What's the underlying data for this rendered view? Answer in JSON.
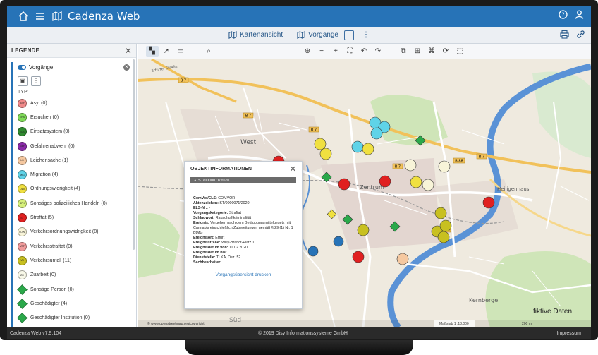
{
  "app": {
    "title": "Cadenza Web"
  },
  "header": {
    "help_icon": "help-circle-icon",
    "user_icon": "user-icon"
  },
  "nav": {
    "tabs": [
      {
        "label": "Kartenansicht",
        "icon": "map-icon"
      },
      {
        "label": "Vorgänge",
        "icon": "map-icon"
      }
    ]
  },
  "legend": {
    "title": "LEGENDE",
    "layer": {
      "label": "Vorgänge"
    },
    "typ_label": "TYP",
    "items": [
      {
        "label": "Asyl (0)",
        "abbr": "ASY",
        "color": "#f08a8a",
        "shape": "circle"
      },
      {
        "label": "Ersuchen (0)",
        "abbr": "ERS",
        "color": "#7ed957",
        "shape": "circle"
      },
      {
        "label": "Einsatzsystem (0)",
        "abbr": "ELS",
        "color": "#2f8a2f",
        "shape": "circle"
      },
      {
        "label": "Gefahrenabwehr (0)",
        "abbr": "GEF",
        "color": "#8a2aa8",
        "shape": "circle"
      },
      {
        "label": "Leichensache (1)",
        "abbr": "LS",
        "color": "#f5c8a0",
        "shape": "circle"
      },
      {
        "label": "Migration (4)",
        "abbr": "MIG",
        "color": "#5fd3e8",
        "shape": "circle"
      },
      {
        "label": "Ordnungswidrigkeit (4)",
        "abbr": "OWI",
        "color": "#f0e040",
        "shape": "circle"
      },
      {
        "label": "Sonstiges polizeiliches Handeln (0)",
        "abbr": "SPH",
        "color": "#d6f07a",
        "shape": "circle"
      },
      {
        "label": "Straftat (5)",
        "abbr": "ST",
        "color": "#e02020",
        "shape": "circle"
      },
      {
        "label": "Verkehrsordnungswidrigkeit (8)",
        "abbr": "VOWI",
        "color": "#f8f4d8",
        "shape": "circle"
      },
      {
        "label": "Verkehrsstraftat (0)",
        "abbr": "VST",
        "color": "#f09a9a",
        "shape": "circle"
      },
      {
        "label": "Verkehrsunfall (11)",
        "abbr": "VU",
        "color": "#c8c020",
        "shape": "circle"
      },
      {
        "label": "Zuarbeit (0)",
        "abbr": "ZU",
        "color": "#f8f8e8",
        "shape": "circle"
      },
      {
        "label": "Sonstige Person (0)",
        "abbr": "",
        "color": "#2aa84a",
        "shape": "diamond"
      },
      {
        "label": "Geschädigter (4)",
        "abbr": "",
        "color": "#2aa84a",
        "shape": "diamond"
      },
      {
        "label": "Geschädigter Institution (0)",
        "abbr": "",
        "color": "#2aa84a",
        "shape": "diamond"
      }
    ]
  },
  "popup": {
    "title": "OBJEKTINFORMATIONEN",
    "band": "ST/0000071/2020",
    "lines": [
      {
        "k": "ComVor/ELS:",
        "v": "COMVOR"
      },
      {
        "k": "Aktenzeichen:",
        "v": "ST/0000071/2020"
      },
      {
        "k": "ELS-Nr.:",
        "v": "-"
      },
      {
        "k": "Vorgangskategorie:",
        "v": "Straftat"
      },
      {
        "k": "Schlagwort:",
        "v": "Rauschgiftkriminalität"
      },
      {
        "k": "Ereignis:",
        "v": "Vergehen nach dem Betäubungsmittelgesetz mit Cannabis einschließlich Zubereitungen gemäß § 29 (1) Nr. 1 BtMG"
      },
      {
        "k": "Ereignisort:",
        "v": "Erfurt"
      },
      {
        "k": "Ereignisstraße:",
        "v": "Willy-Brandt-Platz 1"
      },
      {
        "k": "Ereignisdatum von:",
        "v": "11.02.2020"
      },
      {
        "k": "Ereignisdatum bis:",
        "v": ""
      },
      {
        "k": "Dienststelle:",
        "v": "TLKA, Dez. 52"
      },
      {
        "k": "Sachbearbeiter:",
        "v": ""
      }
    ],
    "link": "Vorgangsübersicht drucken"
  },
  "map": {
    "labels": {
      "street": "Erfurter Straße",
      "west": "West",
      "zentrum": "Zentrum",
      "heiligenhaus": "Heiligenhaus",
      "kernberge": "Kernberge",
      "sud": "Süd",
      "b7": "B 7",
      "b88": "B 88"
    },
    "attribution": "© www.openstreetmap.org/copyright",
    "scale": "Maßstab 1 :18.000",
    "scalebar": "200 m",
    "watermark": "fiktive Daten"
  },
  "footer": {
    "version": "Cadenza Web v7.9.104",
    "copyright": "© 2019 Disy Informationssysteme GmbH",
    "impressum": "Impressum"
  }
}
